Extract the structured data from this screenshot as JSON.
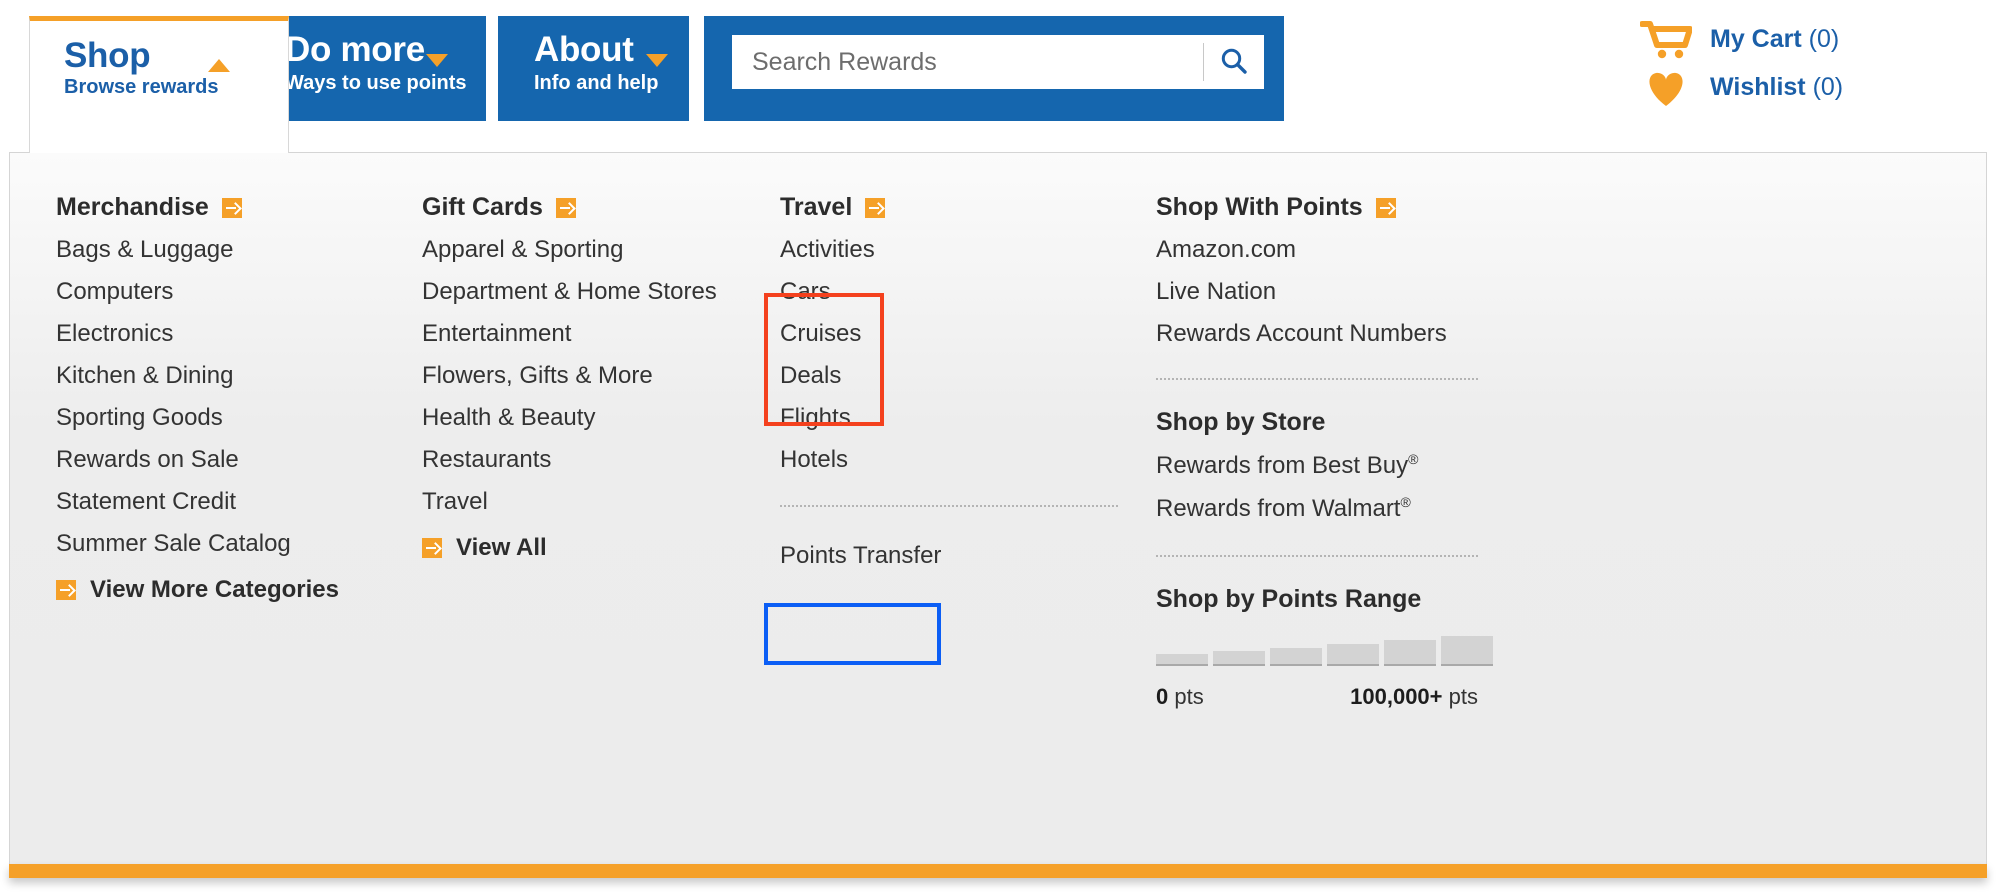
{
  "header": {
    "tabs": [
      {
        "id": "shop",
        "title": "Shop",
        "subtitle": "Browse rewards",
        "caret": "caret-up",
        "active": true
      },
      {
        "id": "do-more",
        "title": "Do more",
        "subtitle": "Ways to use points",
        "caret": "caret-down",
        "active": false
      },
      {
        "id": "about",
        "title": "About",
        "subtitle": "Info and help",
        "caret": "caret-down",
        "active": false
      }
    ],
    "search": {
      "placeholder": "Search Rewards",
      "value": "",
      "icon": "search-icon"
    },
    "account": {
      "cart": {
        "icon": "shopping-cart-icon",
        "label": "My Cart",
        "count": "(0)"
      },
      "wishlist": {
        "icon": "heart-icon",
        "label": "Wishlist",
        "count": "(0)"
      }
    }
  },
  "menu": {
    "columns": {
      "merchandise": {
        "heading": "Merchandise",
        "heading_icon": "arrow-right-square-icon",
        "items": [
          "Bags & Luggage",
          "Computers",
          "Electronics",
          "Kitchen & Dining",
          "Sporting Goods",
          "Rewards on Sale",
          "Statement Credit",
          "Summer Sale Catalog"
        ],
        "footer_link": "View More Categories",
        "footer_icon": "arrow-right-square-icon"
      },
      "gift_cards": {
        "heading": "Gift Cards",
        "heading_icon": "arrow-right-square-icon",
        "items": [
          "Apparel & Sporting",
          "Department & Home Stores",
          "Entertainment",
          "Flowers, Gifts & More",
          "Health & Beauty",
          "Restaurants",
          "Travel"
        ],
        "footer_link": "View All",
        "footer_icon": "arrow-right-square-icon"
      },
      "travel": {
        "heading": "Travel",
        "heading_icon": "arrow-right-square-icon",
        "items": [
          "Activities",
          "Cars",
          "Cruises",
          "Deals",
          "Flights",
          "Hotels"
        ],
        "points_transfer": "Points Transfer"
      },
      "shop_with_points": {
        "heading": "Shop With Points",
        "heading_icon": "arrow-right-square-icon",
        "items": [
          "Amazon.com",
          "Live Nation",
          "Rewards Account Numbers"
        ],
        "store_heading": "Shop by Store",
        "stores": [
          {
            "name": "Rewards from Best Buy",
            "mark": "®"
          },
          {
            "name": "Rewards from Walmart",
            "mark": "®"
          }
        ],
        "range_heading": "Shop by Points Range",
        "range_min": "0",
        "range_min_unit": "pts",
        "range_max": "100,000+",
        "range_max_unit": "pts",
        "range_segments": [
          12,
          15,
          18,
          22,
          26,
          30
        ]
      }
    }
  },
  "highlights": {
    "travel_box_color": "#F4411E",
    "points_transfer_box_color": "#0B5EF5"
  },
  "colors": {
    "brand_blue": "#1566AE",
    "brand_orange": "#F5A028",
    "link_blue": "#1B5FA8",
    "panel_bg": "#ececec"
  }
}
